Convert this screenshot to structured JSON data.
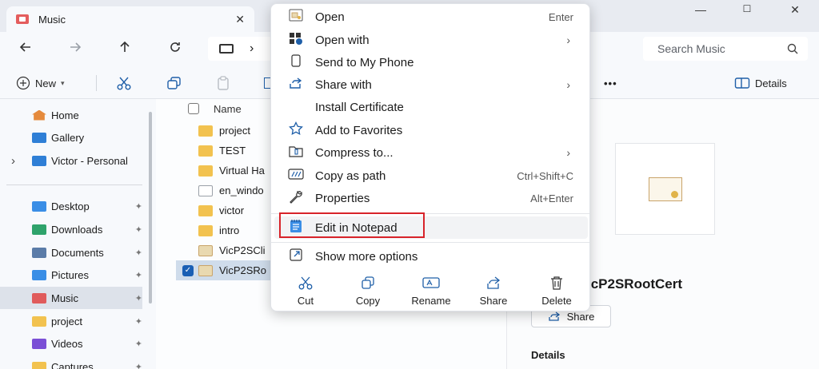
{
  "window": {
    "tab_title": "Music",
    "tab_close": "✕",
    "minimize": "—",
    "maximize": "☐",
    "close": "✕"
  },
  "address": {
    "separator": "›",
    "search_placeholder": "Search Music"
  },
  "toolbar": {
    "new_label": "New",
    "more": "•••",
    "details_label": "Details"
  },
  "sidebar": {
    "items": [
      {
        "label": "Home",
        "icon": "home-icon",
        "color": "#e58a3c"
      },
      {
        "label": "Gallery",
        "icon": "gallery-icon",
        "color": "#2f7fd6"
      },
      {
        "label": "Victor - Personal",
        "icon": "cloud-icon",
        "color": "#2f7fd6"
      },
      {
        "label": "Desktop",
        "icon": "desktop-icon",
        "color": "#3a8ee6"
      },
      {
        "label": "Downloads",
        "icon": "downloads-icon",
        "color": "#2fa36b"
      },
      {
        "label": "Documents",
        "icon": "documents-icon",
        "color": "#5b7ca8"
      },
      {
        "label": "Pictures",
        "icon": "pictures-icon",
        "color": "#3a8ee6"
      },
      {
        "label": "Music",
        "icon": "music-icon",
        "color": "#e05b5b"
      },
      {
        "label": "project",
        "icon": "folder-icon",
        "color": "#f2c24f"
      },
      {
        "label": "Videos",
        "icon": "videos-icon",
        "color": "#7b4fd6"
      },
      {
        "label": "Captures",
        "icon": "folder-icon",
        "color": "#f2c24f"
      }
    ],
    "expand_arrow": "›",
    "pin": "📌"
  },
  "filelist": {
    "header_name": "Name",
    "rows": [
      {
        "label": "project",
        "icon": "folder-icon",
        "color": "#f2c24f"
      },
      {
        "label": "TEST",
        "icon": "folder-icon",
        "color": "#f2c24f"
      },
      {
        "label": "Virtual Ha",
        "icon": "folder-icon",
        "color": "#f2c24f"
      },
      {
        "label": "en_windo",
        "icon": "disc-image-icon",
        "color": "#cfd3d9"
      },
      {
        "label": "victor",
        "icon": "folder-icon",
        "color": "#f2c24f"
      },
      {
        "label": "intro",
        "icon": "folder-icon",
        "color": "#f2c24f"
      },
      {
        "label": "VicP2SCli",
        "icon": "certificate-icon",
        "color": "#e9d9b0"
      },
      {
        "label": "VicP2SRo",
        "icon": "certificate-icon",
        "color": "#e9d9b0"
      }
    ]
  },
  "details": {
    "title": "icP2SRootCert",
    "share_label": "Share",
    "section_label": "Details"
  },
  "context_menu": {
    "items": [
      {
        "label": "Open",
        "icon": "open-icon",
        "shortcut": "Enter",
        "arrow": ""
      },
      {
        "label": "Open with",
        "icon": "open-with-icon",
        "shortcut": "",
        "arrow": "›"
      },
      {
        "label": "Send to My Phone",
        "icon": "phone-icon",
        "shortcut": "",
        "arrow": ""
      },
      {
        "label": "Share with",
        "icon": "share-with-icon",
        "shortcut": "",
        "arrow": "›"
      },
      {
        "label": "Install Certificate",
        "icon": "",
        "shortcut": "",
        "arrow": ""
      },
      {
        "label": "Add to Favorites",
        "icon": "star-icon",
        "shortcut": "",
        "arrow": ""
      },
      {
        "label": "Compress to...",
        "icon": "zip-icon",
        "shortcut": "",
        "arrow": "›"
      },
      {
        "label": "Copy as path",
        "icon": "copy-path-icon",
        "shortcut": "Ctrl+Shift+C",
        "arrow": ""
      },
      {
        "label": "Properties",
        "icon": "wrench-icon",
        "shortcut": "Alt+Enter",
        "arrow": ""
      }
    ],
    "edit_notepad": "Edit in Notepad",
    "show_more": "Show more options",
    "quick_actions": [
      {
        "label": "Cut",
        "icon": "cut-icon"
      },
      {
        "label": "Copy",
        "icon": "copy-icon"
      },
      {
        "label": "Rename",
        "icon": "rename-icon"
      },
      {
        "label": "Share",
        "icon": "share-icon"
      },
      {
        "label": "Delete",
        "icon": "delete-icon"
      }
    ]
  },
  "colors": {
    "accent": "#1f5fa8",
    "highlight_border": "#d8232a",
    "selection": "#cfdceb"
  }
}
